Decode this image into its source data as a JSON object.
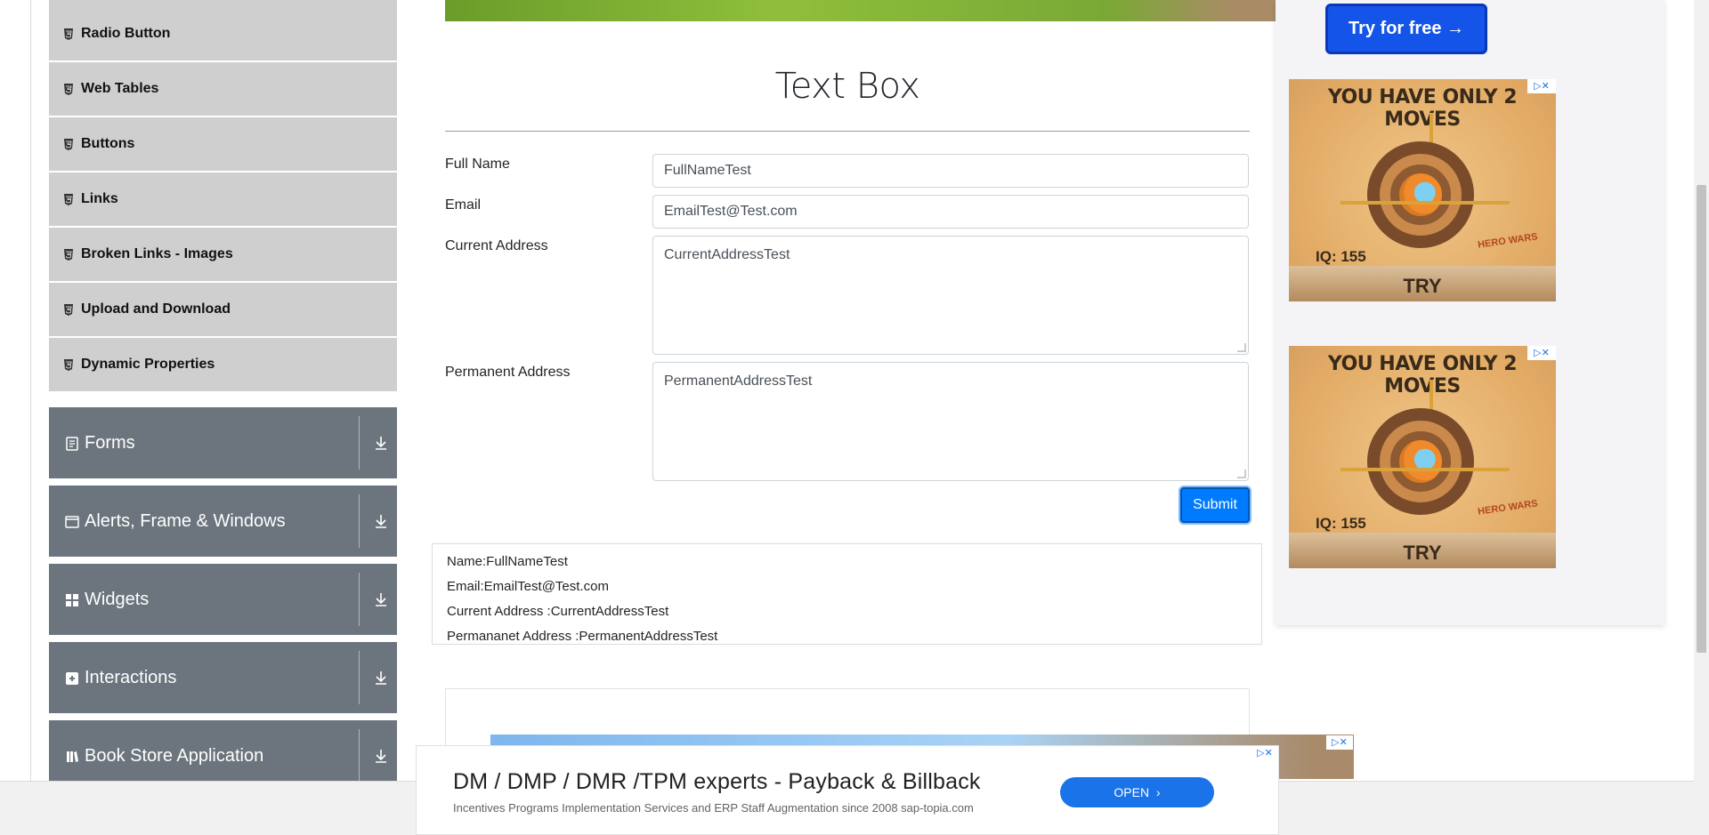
{
  "sidebar": {
    "elements_items": [
      {
        "label": "Radio Button"
      },
      {
        "label": "Web Tables"
      },
      {
        "label": "Buttons"
      },
      {
        "label": "Links"
      },
      {
        "label": "Broken Links - Images"
      },
      {
        "label": "Upload and Download"
      },
      {
        "label": "Dynamic Properties"
      }
    ],
    "groups": [
      {
        "label": "Forms",
        "icon": "forms-icon"
      },
      {
        "label": "Alerts, Frame & Windows",
        "icon": "window-icon"
      },
      {
        "label": "Widgets",
        "icon": "widgets-icon"
      },
      {
        "label": "Interactions",
        "icon": "interactions-icon"
      },
      {
        "label": "Book Store Application",
        "icon": "book-icon"
      }
    ]
  },
  "main": {
    "title": "Text Box",
    "form": {
      "full_name_label": "Full Name",
      "full_name_value": "FullNameTest",
      "email_label": "Email",
      "email_value": "EmailTest@Test.com",
      "current_address_label": "Current Address",
      "current_address_value": "CurrentAddressTest",
      "permanent_address_label": "Permanent Address",
      "permanent_address_value": "PermanentAddressTest",
      "submit_label": "Submit"
    },
    "output": {
      "name": "Name:FullNameTest",
      "email": "Email:EmailTest@Test.com",
      "current_address": "Current Address :CurrentAddressTest",
      "permanent_address": "Permananet Address :PermanentAddressTest"
    }
  },
  "ads": {
    "try_button": "Try for free →",
    "game_ad": {
      "headline": "YOU HAVE ONLY 2 MOVES",
      "iq": "IQ: 155",
      "brand": "HERO WARS",
      "cta": "TRY"
    },
    "bottom_ad": {
      "headline": "DM / DMP / DMR /TPM experts - Payback & Billback",
      "subtext": "Incentives Programs Implementation Services and ERP Staff Augmentation since 2008 sap-topia.com",
      "cta": "OPEN"
    }
  },
  "colors": {
    "sidebar_sub": "#cfcfcf",
    "sidebar_group": "#6c757d",
    "primary": "#007bff"
  }
}
